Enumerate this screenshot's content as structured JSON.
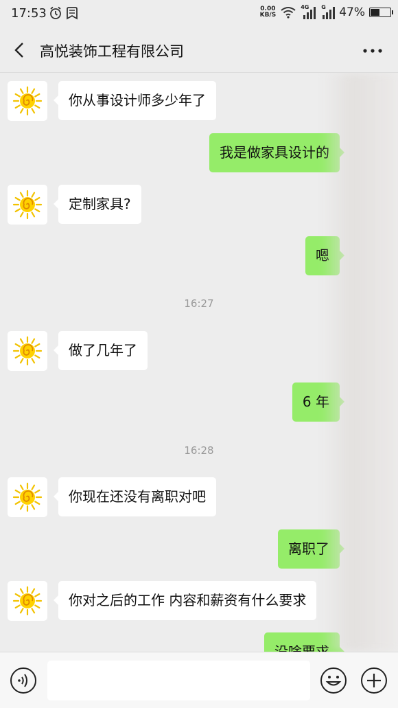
{
  "status_bar": {
    "time": "17:53",
    "net_speed_value": "0.00",
    "net_speed_unit": "KB/S",
    "signal_label_1": "4G",
    "signal_label_2": "G",
    "battery": "47%",
    "battery_level": 0.47
  },
  "header": {
    "title": "高悦装饰工程有限公司"
  },
  "messages": [
    {
      "side": "in",
      "text": "你从事设计师多少年了"
    },
    {
      "side": "out",
      "text": "我是做家具设计的"
    },
    {
      "side": "in",
      "text": "定制家具?"
    },
    {
      "side": "out",
      "text": "嗯"
    },
    {
      "side": "in",
      "text": "做了几年了"
    },
    {
      "side": "out",
      "text": "6 年"
    },
    {
      "side": "in",
      "text": "你现在还没有离职对吧"
    },
    {
      "side": "out",
      "text": "离职了"
    },
    {
      "side": "in",
      "text": "你对之后的工作 内容和薪资有什么要求"
    },
    {
      "side": "out",
      "text": "没啥要求"
    }
  ],
  "timestamps": [
    "16:27",
    "16:28"
  ],
  "icons": {
    "back": "back-arrow-icon",
    "more": "more-dots-icon",
    "avatar": "sun-swirl-avatar",
    "voice": "voice-icon",
    "emoji": "emoji-icon",
    "plus": "plus-icon"
  },
  "colors": {
    "outgoing_bubble": "#95ec69",
    "incoming_bubble": "#ffffff",
    "background": "#ededed"
  }
}
